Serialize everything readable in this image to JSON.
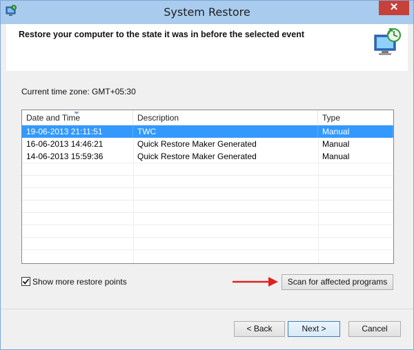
{
  "window": {
    "title": "System Restore",
    "close_label": "✕"
  },
  "header": {
    "heading": "Restore your computer to the state it was in before the selected event"
  },
  "timezone_text": "Current time zone: GMT+05:30",
  "restore_points": {
    "columns": [
      "Date and Time",
      "Description",
      "Type"
    ],
    "rows": [
      {
        "date": "19-06-2013 21:11:51",
        "description": "TWC",
        "type": "Manual",
        "selected": true
      },
      {
        "date": "16-06-2013 14:46:21",
        "description": "Quick Restore Maker Generated",
        "type": "Manual",
        "selected": false
      },
      {
        "date": "14-06-2013 15:59:36",
        "description": "Quick Restore Maker Generated",
        "type": "Manual",
        "selected": false
      }
    ]
  },
  "show_more": {
    "label": "Show more restore points",
    "checked": true
  },
  "buttons": {
    "scan": "Scan for affected programs",
    "back": "< Back",
    "next": "Next >",
    "cancel": "Cancel"
  },
  "colors": {
    "selection": "#3399ff",
    "titlebar": "#a9cbee",
    "close": "#c7413b",
    "arrow": "#e02020"
  }
}
